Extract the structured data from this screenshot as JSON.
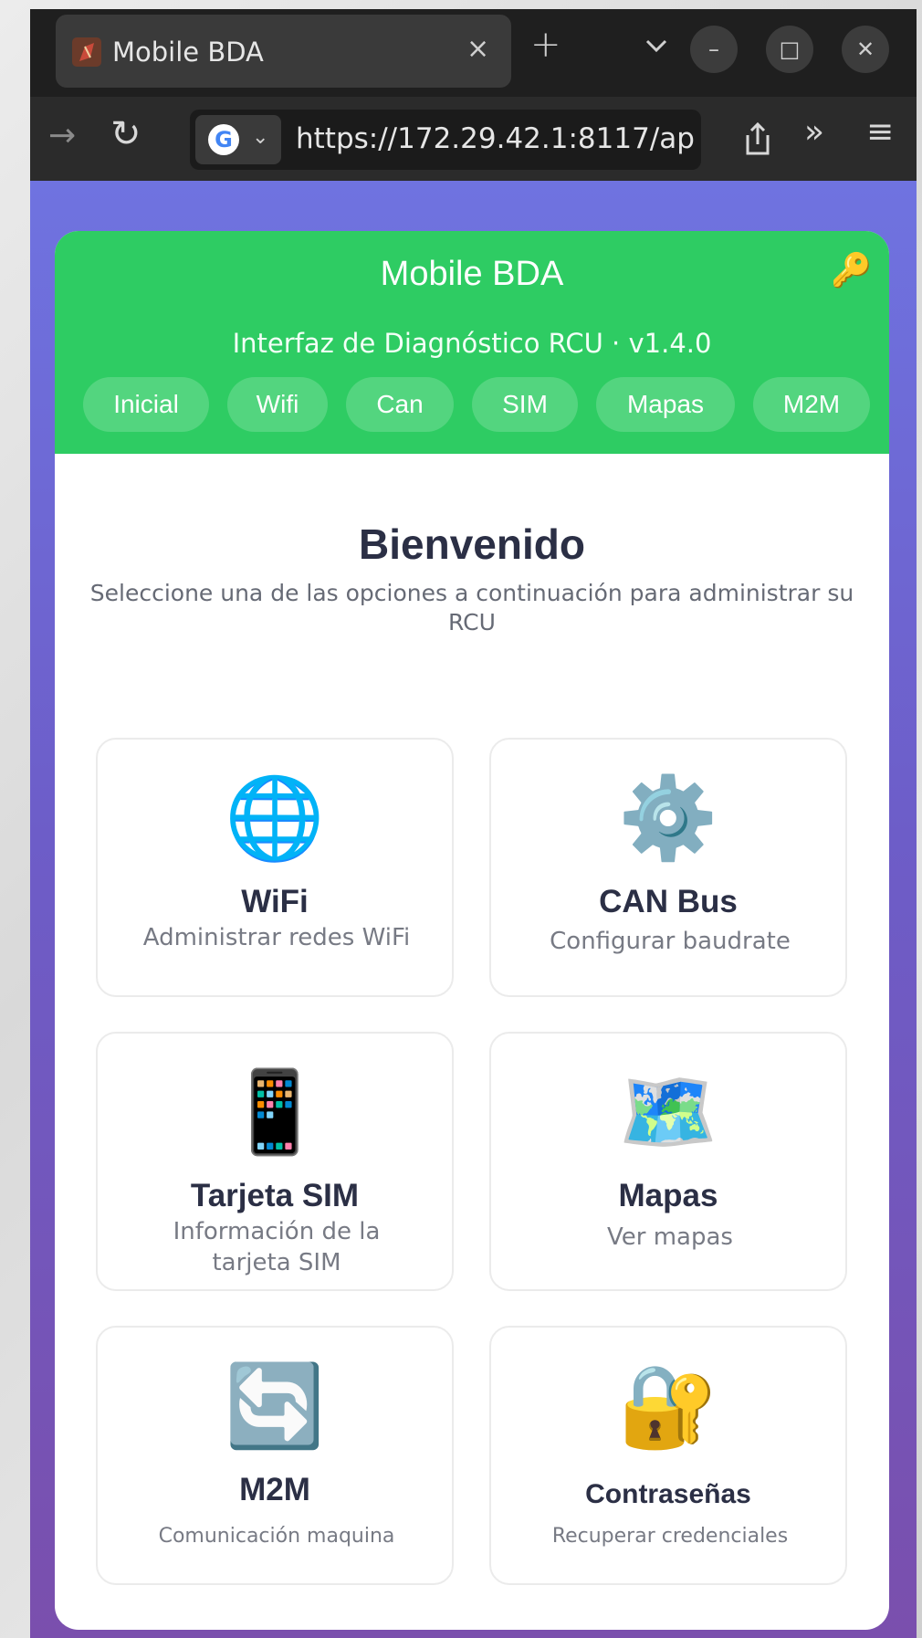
{
  "browser": {
    "tab_title": "Mobile BDA",
    "tab_close": "×",
    "new_tab": "+",
    "url": "https://172.29.42.1:8117/ap",
    "window_controls": {
      "minimize": "–",
      "maximize": "□",
      "close": "✕"
    }
  },
  "header": {
    "title": "Mobile BDA",
    "subtitle": "Interfaz de Diagnóstico RCU · v1.4.0",
    "accent_color": "#2ecc63"
  },
  "nav": {
    "items": [
      {
        "label": "Inicial"
      },
      {
        "label": "Wifi"
      },
      {
        "label": "Can"
      },
      {
        "label": "SIM"
      },
      {
        "label": "Mapas"
      },
      {
        "label": "M2M"
      }
    ]
  },
  "main": {
    "title": "Bienvenido",
    "description": "Seleccione una de las opciones a continuación para administrar su RCU",
    "tiles": [
      {
        "icon": "globe-icon",
        "glyph": "🌐",
        "title": "WiFi",
        "description": "Administrar redes WiFi"
      },
      {
        "icon": "gear-icon",
        "glyph": "⚙️",
        "title": "CAN Bus",
        "description": "Configurar baudrate"
      },
      {
        "icon": "mobile-phone-icon",
        "glyph": "📱",
        "title": "Tarjeta SIM",
        "description": "Información de la tarjeta SIM"
      },
      {
        "icon": "map-icon",
        "glyph": "🗺️",
        "title": "Mapas",
        "description": "Ver mapas"
      },
      {
        "icon": "arrows-sync-icon",
        "glyph": "🔄",
        "title": "M2M",
        "description": "Comunicación maquina"
      },
      {
        "icon": "lock-key-icon",
        "glyph": "🔐",
        "title": "Contraseñas",
        "description": "Recuperar credenciales"
      }
    ]
  }
}
